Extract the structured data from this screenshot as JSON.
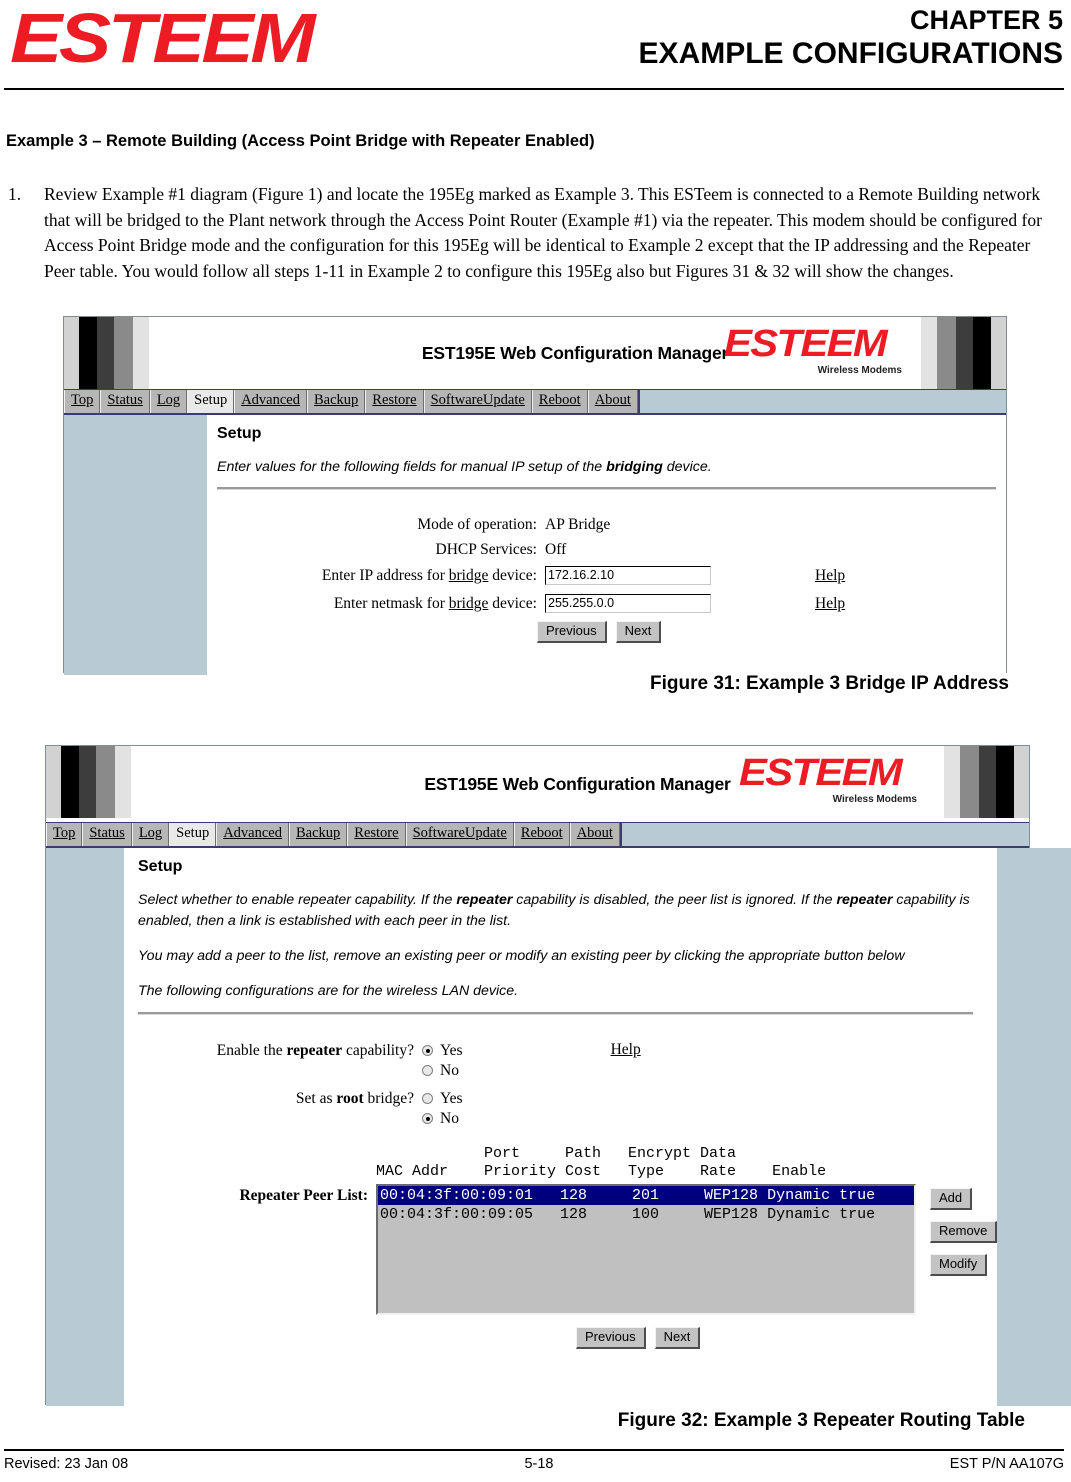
{
  "header": {
    "logo_text": "ESTEEM",
    "chapter": "CHAPTER 5",
    "chapter_subtitle": "EXAMPLE CONFIGURATIONS"
  },
  "content": {
    "section_title": "Example 3 – Remote Building (Access Point Bridge with Repeater Enabled)",
    "list_number": "1.",
    "paragraph": "Review Example #1 diagram (Figure 1) and locate the 195Eg marked as Example 3.  This ESTeem is connected to a Remote Building network that will be bridged to the Plant network through the Access Point Router (Example #1) via the repeater.  This modem should be configured for Access Point Bridge mode and the configuration for this 195Eg will be identical to Example 2 except that the IP addressing and the Repeater Peer table.  You would follow all steps 1-11 in Example 2 to configure this 195Eg also but Figures 31 & 32 will show the changes."
  },
  "app": {
    "title": "EST195E Web Configuration Manager",
    "logo_word": "ESTEEM",
    "logo_sub": "Wireless Modems",
    "nav": [
      {
        "label": "Top",
        "active": false
      },
      {
        "label": "Status",
        "active": false
      },
      {
        "label": "Log",
        "active": false
      },
      {
        "label": "Setup",
        "active": true
      },
      {
        "label": "Advanced",
        "active": false
      },
      {
        "label": "Backup",
        "active": false
      },
      {
        "label": "Restore",
        "active": false
      },
      {
        "label": "SoftwareUpdate",
        "active": false
      },
      {
        "label": "Reboot",
        "active": false
      },
      {
        "label": "About",
        "active": false
      }
    ]
  },
  "figure31": {
    "setup_heading": "Setup",
    "description_pre": "Enter values for the following fields for manual IP setup of the ",
    "description_bold": "bridging",
    "description_post": " device.",
    "rows": {
      "mode_label": "Mode of operation:",
      "mode_value": "AP Bridge",
      "dhcp_label": "DHCP Services:",
      "dhcp_value": "Off",
      "ip_label_a": "Enter IP address for ",
      "ip_label_u": "bridge",
      "ip_label_b": " device:",
      "ip_value": "172.16.2.10",
      "netmask_label_a": "Enter netmask for ",
      "netmask_label_u": "bridge",
      "netmask_label_b": " device:",
      "netmask_value": "255.255.0.0",
      "help_label": "Help"
    },
    "buttons": {
      "previous": "Previous",
      "next": "Next"
    },
    "caption": "Figure 31: Example 3 Bridge IP Address"
  },
  "figure32": {
    "setup_heading": "Setup",
    "desc1_a": "Select whether to enable repeater capability. If the ",
    "desc1_b": "repeater",
    "desc1_c": " capability is disabled, the peer list is ignored. If the ",
    "desc1_d": "repeater",
    "desc1_e": " capability is enabled, then a link is established with each peer in the list.",
    "desc2": "You may add a peer to the list, remove an existing peer or modify an existing peer by clicking the appropriate button below",
    "desc3": "The following configurations are for the wireless LAN device.",
    "repeater_label_a": "Enable the ",
    "repeater_label_b": "repeater",
    "repeater_label_c": " capability?",
    "repeater_yes": "Yes",
    "repeater_no": "No",
    "repeater_selected": "Yes",
    "root_label_a": "Set as ",
    "root_label_b": "root",
    "root_label_c": " bridge?",
    "root_yes": "Yes",
    "root_no": "No",
    "root_selected": "No",
    "help_label": "Help",
    "peer_list_label": "Repeater Peer List:",
    "table_header_line1": "            Port     Path   Encrypt Data",
    "table_header_line2": "MAC Addr    Priority Cost   Type    Rate    Enable",
    "peers": [
      {
        "row": "00:04:3f:00:09:01   128     201     WEP128 Dynamic true",
        "mac": "00:04:3f:00:09:01",
        "port_priority": "128",
        "path_cost": "201",
        "encrypt_type": "WEP128",
        "data_rate": "Dynamic",
        "enable": "true",
        "selected": true
      },
      {
        "row": "00:04:3f:00:09:05   128     100     WEP128 Dynamic true",
        "mac": "00:04:3f:00:09:05",
        "port_priority": "128",
        "path_cost": "100",
        "encrypt_type": "WEP128",
        "data_rate": "Dynamic",
        "enable": "true",
        "selected": false
      }
    ],
    "side_buttons": {
      "add": "Add",
      "remove": "Remove",
      "modify": "Modify"
    },
    "buttons": {
      "previous": "Previous",
      "next": "Next"
    },
    "caption": "Figure 32: Example 3 Repeater Routing Table"
  },
  "footer": {
    "revised": "Revised: 23 Jan 08",
    "page": "5-18",
    "part_number": "EST P/N AA107G"
  },
  "colors": {
    "brand_red": "#ed1c24",
    "sidebar_blue": "#b8cad4",
    "selection_blue": "#00007e",
    "nav_gray": "#b6b6b6"
  }
}
